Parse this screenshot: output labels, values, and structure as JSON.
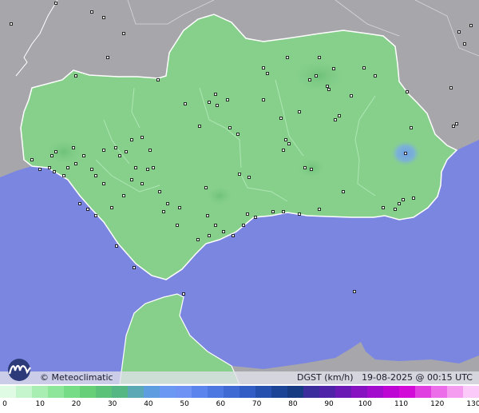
{
  "map": {
    "credit": "Meteoclimatic",
    "variable": "DGST (km/h)",
    "timestamp": "19-08-2025 @ 00:15 UTC",
    "colors": {
      "sea": "#7b86e0",
      "land_outside": "#a7a7ab",
      "region_fill": "#86d08c",
      "region_border": "#ffffff",
      "station_marker": "#000000",
      "gust_hotspot": "#6f9ee6"
    }
  },
  "legend": {
    "ticks": [
      "0",
      "10",
      "20",
      "30",
      "40",
      "50",
      "60",
      "70",
      "80",
      "90",
      "100",
      "110",
      "120",
      "130"
    ],
    "colors": [
      "#dffbe4",
      "#c4f5cc",
      "#a8eeb2",
      "#8ee69a",
      "#77dc86",
      "#66cf77",
      "#5cc27a",
      "#56b784",
      "#5aa9b4",
      "#5e9ddf",
      "#6a98f2",
      "#6e93f5",
      "#5b85ec",
      "#4d78e2",
      "#3f6ad4",
      "#325dc4",
      "#2550ad",
      "#1b4496",
      "#173b82",
      "#3b2d9b",
      "#4e23a8",
      "#6a19b5",
      "#8612c2",
      "#a20ccc",
      "#bd06d4",
      "#d30bd8",
      "#e03ee0",
      "#ec6ee9",
      "#f59cf1",
      "#fbcaf8"
    ]
  }
}
